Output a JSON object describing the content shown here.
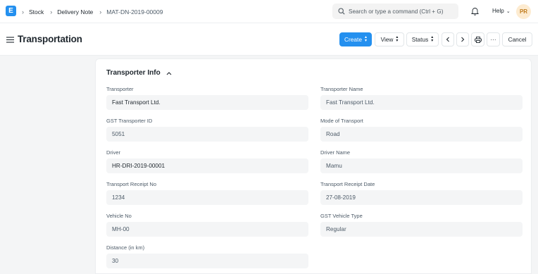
{
  "navbar": {
    "logo_letter": "E",
    "breadcrumbs": [
      "Stock",
      "Delivery Note",
      "MAT-DN-2019-00009"
    ],
    "search_placeholder": "Search or type a command (Ctrl + G)",
    "help_label": "Help",
    "avatar_initials": "PR"
  },
  "page": {
    "title": "Transportation",
    "buttons": {
      "create": "Create",
      "view": "View",
      "status": "Status",
      "more": "···",
      "cancel": "Cancel"
    }
  },
  "section": {
    "title": "Transporter Info",
    "fields": [
      {
        "label": "Transporter",
        "value": "Fast Transport Ltd."
      },
      {
        "label": "Transporter Name",
        "value": "Fast Transport Ltd."
      },
      {
        "label": "GST Transporter ID",
        "value": "5051"
      },
      {
        "label": "Mode of Transport",
        "value": "Road"
      },
      {
        "label": "Driver",
        "value": "HR-DRI-2019-00001"
      },
      {
        "label": "Driver Name",
        "value": "Mamu"
      },
      {
        "label": "Transport Receipt No",
        "value": "1234"
      },
      {
        "label": "Transport Receipt Date",
        "value": "27-08-2019"
      },
      {
        "label": "Vehicle No",
        "value": "MH-00"
      },
      {
        "label": "GST Vehicle Type",
        "value": "Regular"
      },
      {
        "label": "Distance (in km)",
        "value": "30"
      }
    ]
  },
  "colors": {
    "primary": "#2490ef",
    "field_bg": "#f4f5f6",
    "page_bg": "#f4f5f6"
  }
}
